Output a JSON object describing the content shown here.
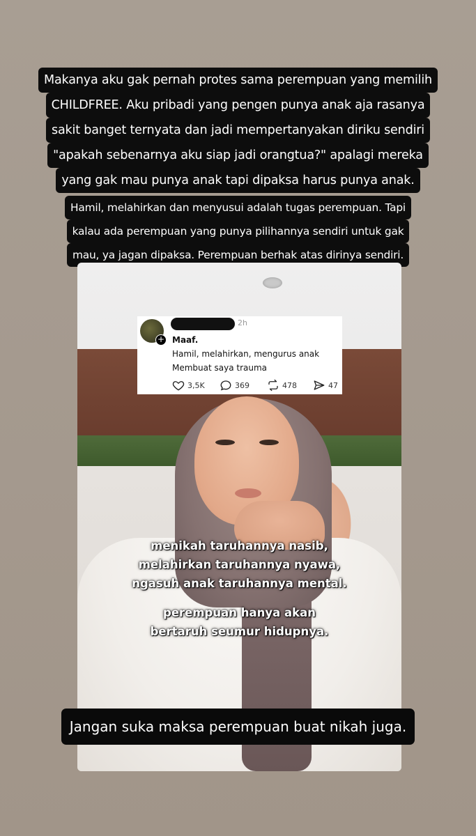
{
  "caption_top": {
    "lines": [
      "Makanya aku gak pernah protes sama perempuan yang memilih",
      "CHILDFREE. Aku pribadi yang pengen punya anak aja rasanya",
      "sakit banget ternyata dan jadi mempertanyakan diriku sendiri",
      "\"apakah sebenarnya aku siap jadi orangtua?\" apalagi mereka",
      "yang gak mau punya anak tapi dipaksa harus punya anak."
    ]
  },
  "caption_middle": {
    "lines": [
      "Hamil, melahirkan dan menyusui adalah tugas perempuan. Tapi",
      "kalau ada perempuan yang punya pilihannya sendiri untuk gak",
      "mau, ya jagan dipaksa. Perempuan berhak atas dirinya sendiri."
    ]
  },
  "tweet": {
    "time": "2h",
    "lines": [
      "Maaf.",
      "Hamil, melahirkan, mengurus anak",
      "Membuat saya trauma"
    ],
    "likes": "3,5K",
    "replies": "369",
    "reposts": "478",
    "shares": "47"
  },
  "video_overlay": {
    "block1": [
      "menikah taruhannya nasib,",
      "melahirkan taruhannya nyawa,",
      "ngasuh anak taruhannya mental."
    ],
    "block2": [
      "perempuan hanya akan",
      "bertaruh seumur hidupnya."
    ]
  },
  "caption_bottom": "Jangan suka maksa perempuan buat nikah juga."
}
